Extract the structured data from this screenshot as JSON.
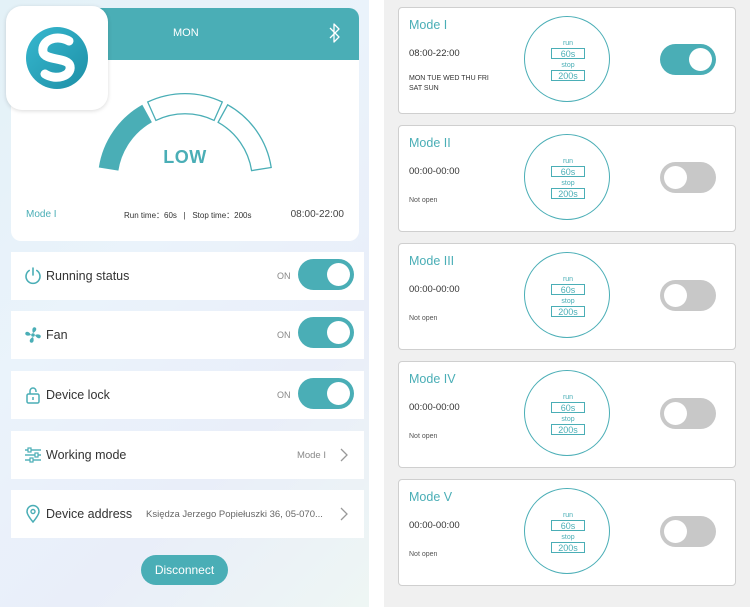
{
  "left": {
    "header": {
      "day": "MON"
    },
    "gauge": {
      "level": "LOW",
      "filled_segments": 1,
      "total_segments": 3
    },
    "summary": {
      "mode": "Mode I",
      "run_time": "Run time：60s",
      "separator": "|",
      "stop_time": "Stop time：200s",
      "time_range": "08:00-22:00"
    },
    "settings": [
      {
        "label": "Running status",
        "state": "ON",
        "toggle_on": true
      },
      {
        "label": "Fan",
        "state": "ON",
        "toggle_on": true
      },
      {
        "label": "Device lock",
        "state": "ON",
        "toggle_on": true
      },
      {
        "label": "Working mode",
        "value": "Mode I"
      },
      {
        "label": "Device address",
        "value": "Księdza Jerzego Popiełuszki 36, 05-070..."
      }
    ],
    "disconnect_label": "Disconnect"
  },
  "modes": [
    {
      "name": "Mode I",
      "time": "08:00-22:00",
      "days": "MON TUE WED THU FRI SAT SUN",
      "run_label": "run",
      "run": "60s",
      "stop_label": "stop",
      "stop": "200s",
      "enabled": true
    },
    {
      "name": "Mode II",
      "time": "00:00-00:00",
      "status": "Not open",
      "run_label": "run",
      "run": "60s",
      "stop_label": "stop",
      "stop": "200s",
      "enabled": false
    },
    {
      "name": "Mode III",
      "time": "00:00-00:00",
      "status": "Not open",
      "run_label": "run",
      "run": "60s",
      "stop_label": "stop",
      "stop": "200s",
      "enabled": false
    },
    {
      "name": "Mode IV",
      "time": "00:00-00:00",
      "status": "Not open",
      "run_label": "run",
      "run": "60s",
      "stop_label": "stop",
      "stop": "200s",
      "enabled": false
    },
    {
      "name": "Mode V",
      "time": "00:00-00:00",
      "status": "Not open",
      "run_label": "run",
      "run": "60s",
      "stop_label": "stop",
      "stop": "200s",
      "enabled": false
    }
  ],
  "colors": {
    "accent": "#4aaeb6",
    "toggle_off": "#c8c8c8"
  },
  "icons": [
    "app-logo-icon",
    "bluetooth-icon",
    "power-icon",
    "fan-icon",
    "lock-icon",
    "sliders-icon",
    "location-pin-icon",
    "chevron-right-icon"
  ]
}
